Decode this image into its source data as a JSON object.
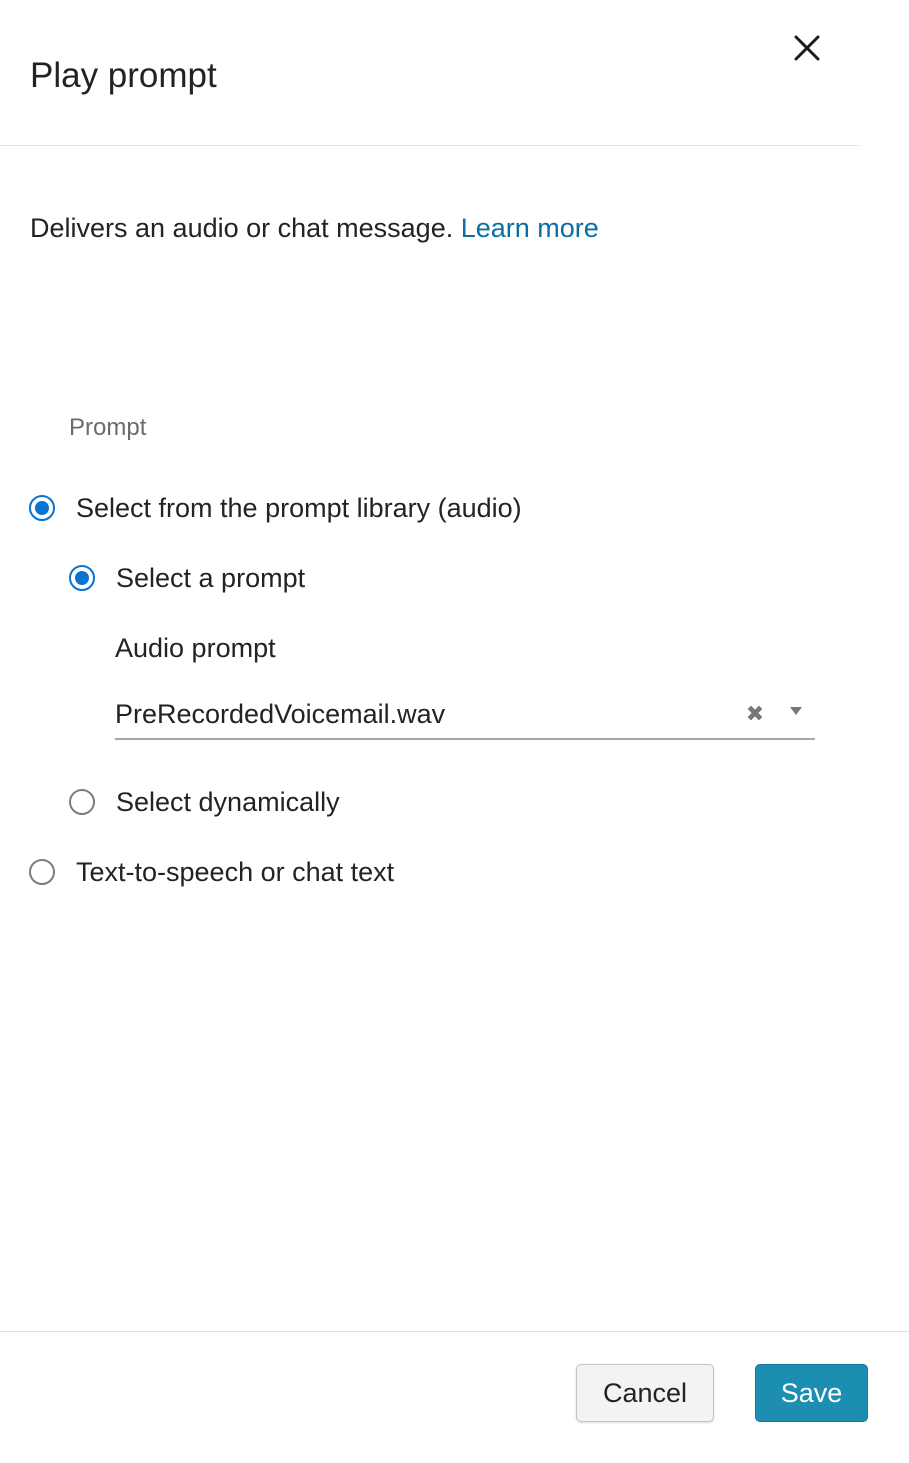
{
  "dialog": {
    "title": "Play prompt",
    "close_icon": "close-icon"
  },
  "description": {
    "text": "Delivers an audio or chat message. ",
    "link_label": "Learn more"
  },
  "prompt": {
    "section_label": "Prompt",
    "options": [
      {
        "label": "Select from the prompt library (audio)",
        "checked": true
      },
      {
        "label": "Text-to-speech or chat text",
        "checked": false
      }
    ],
    "sub_options": [
      {
        "label": "Select a prompt",
        "checked": true
      },
      {
        "label": "Select dynamically",
        "checked": false
      }
    ],
    "audio_prompt": {
      "label": "Audio prompt",
      "value": "PreRecordedVoicemail.wav",
      "clear_icon": "clear-icon",
      "dropdown_icon": "caret-down-icon"
    }
  },
  "footer": {
    "cancel_label": "Cancel",
    "save_label": "Save"
  },
  "colors": {
    "accent": "#0972d3",
    "link": "#0b6ea5",
    "primary_button": "#1b8eb2"
  }
}
